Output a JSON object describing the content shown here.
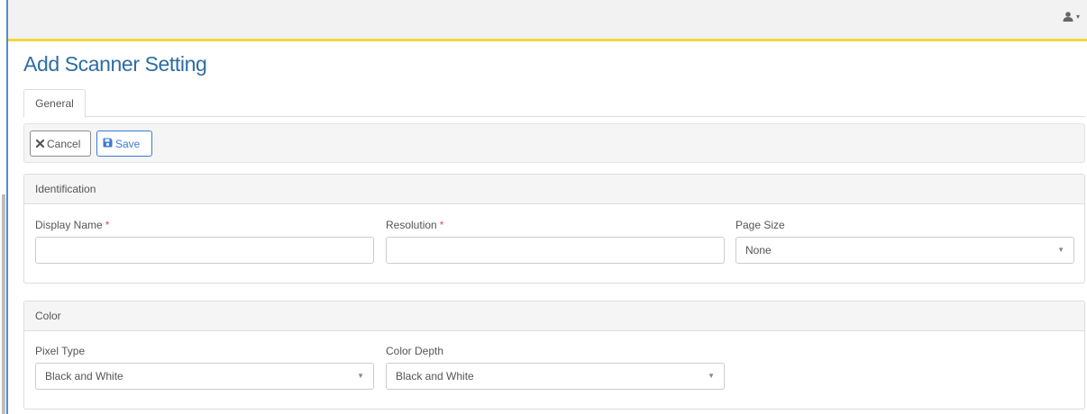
{
  "header": {
    "user_icon": "user-icon",
    "user_caret": "▾"
  },
  "page": {
    "title": "Add Scanner Setting"
  },
  "tabs": [
    {
      "label": "General",
      "active": true
    }
  ],
  "toolbar": {
    "cancel_label": "Cancel",
    "cancel_icon": "close-icon",
    "save_label": "Save",
    "save_icon": "floppy-disk-icon"
  },
  "identification": {
    "heading": "Identification",
    "display_name": {
      "label": "Display Name",
      "required_mark": "*",
      "value": ""
    },
    "resolution": {
      "label": "Resolution",
      "required_mark": "*",
      "value": ""
    },
    "page_size": {
      "label": "Page Size",
      "value": "None"
    }
  },
  "color": {
    "heading": "Color",
    "pixel_type": {
      "label": "Pixel Type",
      "value": "Black and White"
    },
    "color_depth": {
      "label": "Color Depth",
      "value": "Black and White"
    }
  },
  "colors": {
    "title_blue": "#2e6da4",
    "save_blue": "#3a7bd5",
    "header_accent_yellow": "#f2d83b",
    "required_red": "#d9534f"
  }
}
